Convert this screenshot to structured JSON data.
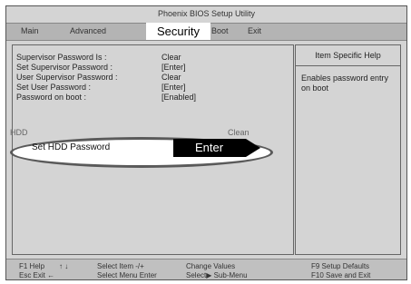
{
  "title": "Phoenix BIOS Setup Utility",
  "menu": {
    "items": [
      "Main",
      "Advanced",
      "Security",
      "Boot",
      "Exit"
    ],
    "active": "Security"
  },
  "security": {
    "rows": [
      {
        "label": "Supervisor Password Is :",
        "value": "Clear"
      },
      {
        "label": "Set Supervisor Password :",
        "value": "[Enter]"
      },
      {
        "label": "User Supervisor Password :",
        "value": "Clear"
      },
      {
        "label": "Set User Password :",
        "value": "[Enter]"
      },
      {
        "label": "Password on boot :",
        "value": "[Enabled]"
      }
    ],
    "hdd_status_label": "HDD",
    "hdd_status_value": "Clean",
    "hdd_password_label": "Set HDD Password",
    "hdd_password_value": "Enter"
  },
  "help": {
    "title": "Item Specific Help",
    "text": "Enables password entry on boot"
  },
  "footer": {
    "f1": "F1 Help",
    "arrows_ud": "↑ ↓",
    "select_item": "Select Item -/+",
    "change_values": "Change Values",
    "f9": "F9 Setup Defaults",
    "esc": "Esc Exit ←",
    "select_menu": "Select Menu Enter",
    "select_sub": "Select▶ Sub-Menu",
    "f10": "F10 Save and Exit"
  }
}
